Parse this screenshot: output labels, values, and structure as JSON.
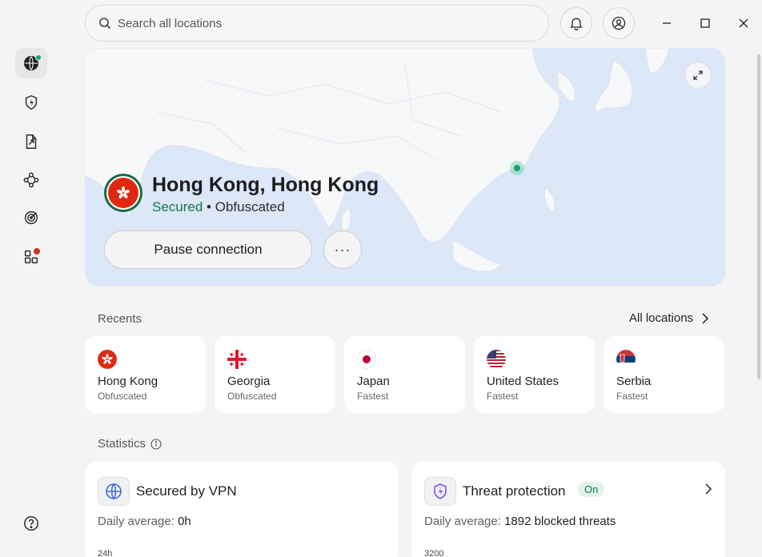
{
  "search": {
    "placeholder": "Search all locations"
  },
  "sidebar": {
    "items": [
      {
        "name": "globe",
        "active": true
      },
      {
        "name": "threat-protection"
      },
      {
        "name": "split-tunneling"
      },
      {
        "name": "meshnet"
      },
      {
        "name": "dark-web-monitor"
      },
      {
        "name": "apps"
      }
    ]
  },
  "connection": {
    "title": "Hong Kong, Hong Kong",
    "status_secured": "Secured",
    "status_separator": " • ",
    "status_protocol": "Obfuscated",
    "pause_label": "Pause connection",
    "more_label": "···"
  },
  "recents": {
    "label": "Recents",
    "all_locations_label": "All locations",
    "items": [
      {
        "name": "Hong Kong",
        "sub": "Obfuscated",
        "flag": "hk"
      },
      {
        "name": "Georgia",
        "sub": "Obfuscated",
        "flag": "ge"
      },
      {
        "name": "Japan",
        "sub": "Fastest",
        "flag": "jp"
      },
      {
        "name": "United States",
        "sub": "Fastest",
        "flag": "us"
      },
      {
        "name": "Serbia",
        "sub": "Fastest",
        "flag": "rs"
      }
    ]
  },
  "statistics": {
    "label": "Statistics",
    "vpn": {
      "title": "Secured by VPN",
      "sub_label": "Daily average: ",
      "sub_value": "0h",
      "axis_top": "24h"
    },
    "threat": {
      "title": "Threat protection",
      "badge": "On",
      "sub_label": "Daily average: ",
      "sub_value": "1892 blocked threats",
      "axis_top": "3200"
    }
  },
  "colors": {
    "accent_green": "#16794c",
    "hk_red": "#de2910",
    "map_water": "#dce7f7"
  }
}
